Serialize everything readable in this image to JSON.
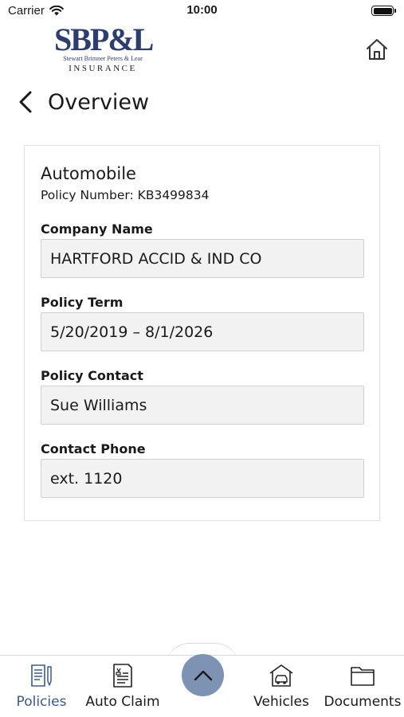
{
  "status_bar": {
    "carrier": "Carrier",
    "time": "10:00"
  },
  "header": {
    "logo": {
      "mark": "SBP&L",
      "subtitle": "Stewart Brimner Peters & Lear",
      "tagline": "INSURANCE"
    },
    "back_icon": "chevron-left-icon",
    "title": "Overview",
    "home_icon": "home-icon"
  },
  "policy": {
    "type": "Automobile",
    "number_text": "Policy Number: KB3499834",
    "fields": [
      {
        "label": "Company Name",
        "value": "HARTFORD ACCID & IND CO"
      },
      {
        "label": "Policy Term",
        "value": "5/20/2019 – 8/1/2026"
      },
      {
        "label": "Policy Contact",
        "value": "Sue Williams"
      },
      {
        "label": "Contact Phone",
        "value": "ext. 1120"
      }
    ]
  },
  "tab_bar": {
    "tabs": [
      {
        "label": "Policies",
        "icon": "policies-document-icon",
        "active": true
      },
      {
        "label": "Auto Claim",
        "icon": "auto-claim-form-icon",
        "active": false
      },
      {
        "label": "Vehicles",
        "icon": "vehicles-garage-icon",
        "active": false
      },
      {
        "label": "Documents",
        "icon": "folder-icon",
        "active": false
      }
    ],
    "center_button_icon": "chevron-up-icon"
  },
  "colors": {
    "brand": "#2d3e6c",
    "active_tab": "#3d5a8c",
    "center_button": "#7e92b4",
    "field_background": "#f2f2f2"
  }
}
